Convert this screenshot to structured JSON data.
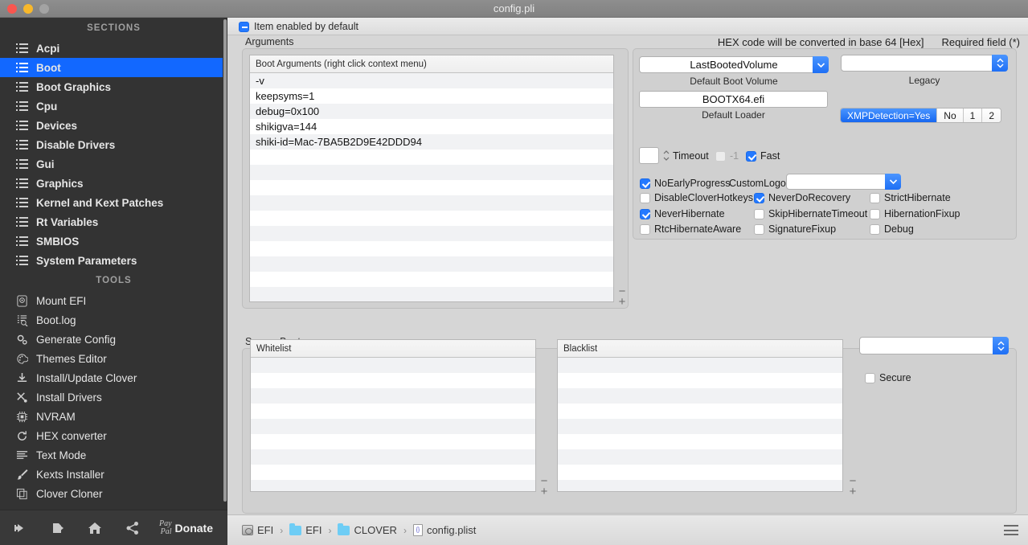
{
  "window": {
    "title": "config.pli"
  },
  "sidebar": {
    "sections_header": "SECTIONS",
    "sections": [
      {
        "label": "Acpi",
        "selected": false
      },
      {
        "label": "Boot",
        "selected": true
      },
      {
        "label": "Boot Graphics",
        "selected": false
      },
      {
        "label": "Cpu",
        "selected": false
      },
      {
        "label": "Devices",
        "selected": false
      },
      {
        "label": "Disable Drivers",
        "selected": false
      },
      {
        "label": "Gui",
        "selected": false
      },
      {
        "label": "Graphics",
        "selected": false
      },
      {
        "label": "Kernel and Kext Patches",
        "selected": false
      },
      {
        "label": "Rt Variables",
        "selected": false
      },
      {
        "label": "SMBIOS",
        "selected": false
      },
      {
        "label": "System Parameters",
        "selected": false
      }
    ],
    "tools_header": "TOOLS",
    "tools": [
      {
        "label": "Mount EFI",
        "icon": "disk-icon"
      },
      {
        "label": "Boot.log",
        "icon": "log-search-icon"
      },
      {
        "label": "Generate Config",
        "icon": "gears-icon"
      },
      {
        "label": "Themes Editor",
        "icon": "palette-icon"
      },
      {
        "label": "Install/Update Clover",
        "icon": "download-icon"
      },
      {
        "label": "Install Drivers",
        "icon": "tools-icon"
      },
      {
        "label": "NVRAM",
        "icon": "chip-icon"
      },
      {
        "label": "HEX converter",
        "icon": "refresh-icon"
      },
      {
        "label": "Text Mode",
        "icon": "text-lines-icon"
      },
      {
        "label": "Kexts Installer",
        "icon": "brush-icon"
      },
      {
        "label": "Clover Cloner",
        "icon": "copy-icon"
      }
    ],
    "bottom_toolbar": {
      "buttons": [
        {
          "icon": "import-icon",
          "label": ""
        },
        {
          "icon": "export-icon",
          "label": ""
        },
        {
          "icon": "home-icon",
          "label": ""
        },
        {
          "icon": "share-icon",
          "label": ""
        }
      ],
      "paypal_line1": "Pay",
      "paypal_line2": "Pal",
      "donate_label": "Donate"
    }
  },
  "header": {
    "item_enabled_label": "Item enabled by default",
    "hex_note": "HEX code will be converted in base 64 [Hex]",
    "required_note": "Required field (*)"
  },
  "arguments_group": {
    "label": "Arguments",
    "table_header": "Boot Arguments (right click context menu)",
    "rows": [
      "-v",
      "keepsyms=1",
      "debug=0x100",
      "shikigva=144",
      "shiki-id=Mac-7BA5B2D9E42DDD94"
    ],
    "empty_rows": 10,
    "remove_label": "−",
    "add_label": "+"
  },
  "boot_options": {
    "default_boot_volume": {
      "value": "LastBootedVolume",
      "caption": "Default Boot Volume"
    },
    "legacy": {
      "value": "",
      "caption": "Legacy"
    },
    "default_loader": {
      "value": "BOOTX64.efi",
      "caption": "Default Loader"
    },
    "xmp_segments": [
      {
        "label": "XMPDetection=Yes",
        "active": true
      },
      {
        "label": "No",
        "active": false
      },
      {
        "label": "1",
        "active": false
      },
      {
        "label": "2",
        "active": false
      }
    ],
    "timeout": {
      "value": "",
      "label": "Timeout"
    },
    "minus_one": {
      "label": "-1",
      "checked": false,
      "disabled": true
    },
    "fast": {
      "label": "Fast",
      "checked": true
    },
    "no_early_progress": {
      "label": "NoEarlyProgress",
      "checked": true
    },
    "custom_logo": {
      "label": "CustomLogo",
      "value": ""
    },
    "checkboxes": [
      {
        "label": "DisableCloverHotkeys",
        "checked": false
      },
      {
        "label": "NeverDoRecovery",
        "checked": true
      },
      {
        "label": "StrictHibernate",
        "checked": false
      },
      {
        "label": "NeverHibernate",
        "checked": true
      },
      {
        "label": "SkipHibernateTimeout",
        "checked": false
      },
      {
        "label": "HibernationFixup",
        "checked": false
      },
      {
        "label": "RtcHibernateAware",
        "checked": false
      },
      {
        "label": "SignatureFixup",
        "checked": false
      },
      {
        "label": "Debug",
        "checked": false
      }
    ]
  },
  "secure_boot": {
    "label": "Secure Boot",
    "whitelist_header": "Whitelist",
    "blacklist_header": "Blacklist",
    "whitelist_rows": [],
    "blacklist_rows": [],
    "policy": {
      "value": ""
    },
    "secure": {
      "label": "Secure",
      "checked": false
    },
    "remove_label": "−",
    "add_label": "+"
  },
  "statusbar": {
    "breadcrumb": [
      {
        "label": "EFI",
        "icon": "disk-icon"
      },
      {
        "label": "EFI",
        "icon": "folder-icon"
      },
      {
        "label": "CLOVER",
        "icon": "folder-icon"
      },
      {
        "label": "config.plist",
        "icon": "plist-file-icon"
      }
    ],
    "separator": "›"
  },
  "colors": {
    "accent": "#1268ff",
    "sidebar_bg": "#333333",
    "panel_bg": "#d6d6d6"
  }
}
